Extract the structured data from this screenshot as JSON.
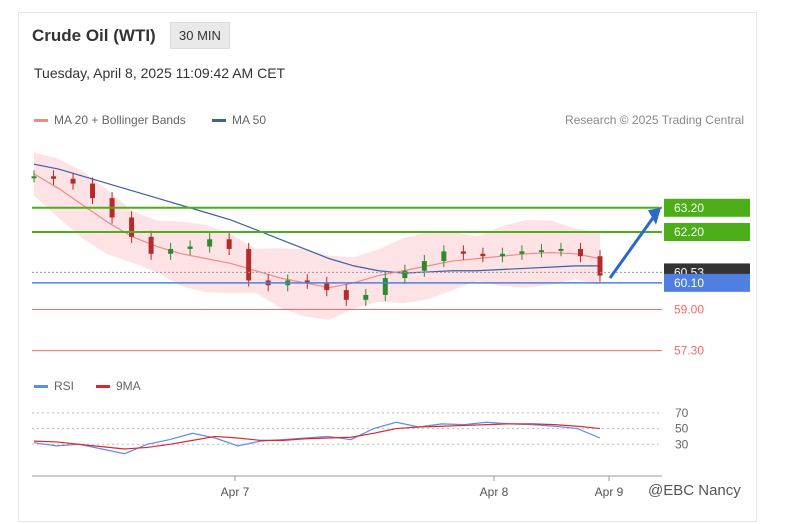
{
  "header": {
    "title": "Crude Oil (WTI)",
    "interval": "30 MIN",
    "datetime": "Tuesday, April 8, 2025 11:09:42 AM CET",
    "copyright": "Research © 2025 Trading Central"
  },
  "legend": {
    "ma20": "MA 20 + Bollinger Bands",
    "ma50": "MA 50",
    "rsi": "RSI",
    "ma9": "9MA"
  },
  "colors": {
    "ma20": "#f08a8a",
    "band": "#fde0e2",
    "ma50": "#3c5fa8",
    "rsi": "#5b8def",
    "ma9": "#e0262b",
    "resistance": "#4caf1a",
    "support": "#4f7fe0",
    "lowerSupport": "#f06b6b",
    "up": "#2f8a2f",
    "down": "#b52a2a"
  },
  "watermark": "@EBC Nancy",
  "chart_data": [
    {
      "type": "line",
      "levels": [
        {
          "value": "63.20",
          "kind": "resistance"
        },
        {
          "value": "62.20",
          "kind": "resistance"
        },
        {
          "value": "60.53",
          "kind": "current"
        },
        {
          "value": "60.10",
          "kind": "support"
        },
        {
          "value": "59.00",
          "kind": "lowerSupport"
        },
        {
          "value": "57.30",
          "kind": "lowerSupport"
        }
      ],
      "ylim": [
        56.5,
        66.0
      ],
      "x_ticks": [
        "Apr 7",
        "Apr 8",
        "Apr 9"
      ],
      "series": [
        {
          "name": "MA 50",
          "values": [
            65.0,
            64.8,
            64.5,
            64.2,
            63.9,
            63.6,
            63.3,
            63.0,
            62.7,
            62.3,
            61.9,
            61.5,
            61.1,
            60.8,
            60.6,
            60.5,
            60.55,
            60.6,
            60.6,
            60.65,
            60.7,
            60.75,
            60.8,
            60.8
          ]
        },
        {
          "name": "MA 20 + Bollinger Bands",
          "values": [
            64.6,
            64.0,
            63.3,
            62.6,
            62.0,
            61.6,
            61.3,
            61.1,
            60.9,
            60.6,
            60.3,
            60.1,
            59.9,
            60.1,
            60.4,
            60.6,
            60.8,
            61.0,
            61.1,
            61.2,
            61.3,
            61.35,
            61.3,
            61.1
          ]
        }
      ],
      "candles": [
        64.5,
        64.4,
        64.2,
        63.6,
        62.8,
        62.0,
        61.3,
        61.5,
        61.6,
        61.9,
        61.5,
        60.2,
        60.0,
        60.2,
        60.1,
        59.8,
        59.4,
        59.6,
        60.3,
        60.6,
        61.0,
        61.4,
        61.3,
        61.2,
        61.3,
        61.4,
        61.45,
        61.5,
        61.2,
        60.4
      ]
    },
    {
      "type": "line",
      "ylim": [
        10,
        80
      ],
      "y_ticks": [
        "70",
        "50",
        "30"
      ],
      "series": [
        {
          "name": "RSI",
          "values": [
            32,
            28,
            30,
            24,
            18,
            30,
            36,
            44,
            38,
            28,
            34,
            36,
            38,
            40,
            36,
            50,
            58,
            52,
            56,
            55,
            58,
            56,
            55,
            53,
            50,
            38
          ]
        },
        {
          "name": "9MA",
          "values": [
            34,
            33,
            30,
            27,
            24,
            26,
            30,
            35,
            40,
            38,
            35,
            35,
            37,
            38,
            39,
            44,
            50,
            52,
            53,
            54,
            55,
            56,
            56,
            55,
            53,
            50
          ]
        }
      ]
    }
  ]
}
